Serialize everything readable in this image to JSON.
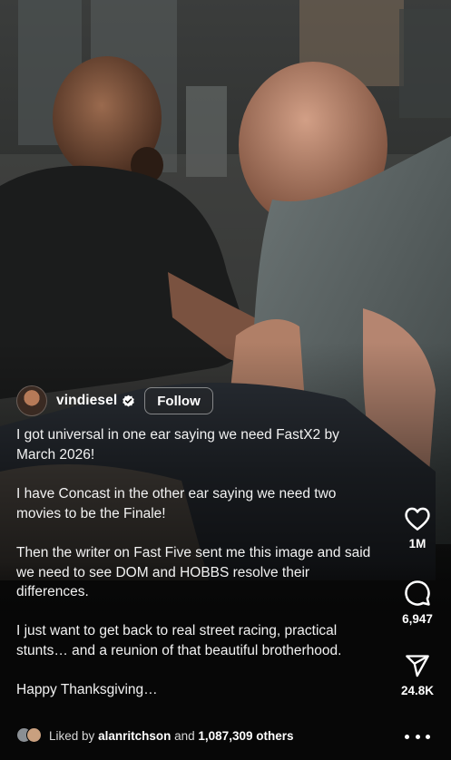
{
  "post": {
    "author": {
      "username": "vindiesel",
      "verified": true,
      "follow_label": "Follow",
      "avatar_icon": "profile-avatar"
    },
    "caption": [
      "I got universal in one ear saying we need FastX2 by March 2026!",
      "I have Concast in the other ear saying we need two movies to be the Finale!",
      "Then the writer on Fast Five sent me this image and said we need to see DOM and HOBBS resolve their differences.",
      "I just want to get back to real street racing, practical stunts… and a reunion of that beautiful brotherhood.",
      "Happy Thanksgiving…"
    ],
    "liked_by": {
      "prefix": "Liked by",
      "user": "alanritchson",
      "connector": "and",
      "others": "1,087,309 others"
    }
  },
  "actions": {
    "like": {
      "icon": "heart-icon",
      "count": "1M"
    },
    "comment": {
      "icon": "comment-bubble-icon",
      "count": "6,947"
    },
    "share": {
      "icon": "paper-plane-icon",
      "count": "24.8K"
    },
    "more": {
      "icon": "more-dots-icon"
    }
  },
  "colors": {
    "background": "#000000",
    "text": "#ffffff",
    "verified_badge": "#ffffff"
  }
}
